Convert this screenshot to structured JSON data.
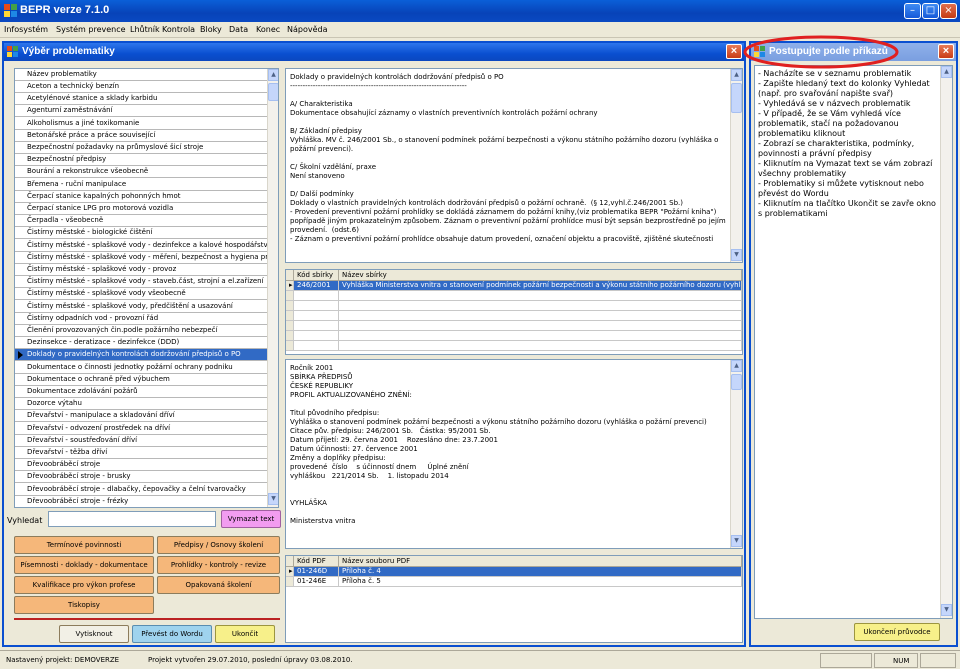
{
  "app": {
    "title": "BEPR verze 7.1.0"
  },
  "menu": [
    "Infosystém",
    "Systém prevence",
    "Lhůtník",
    "Kontrola",
    "Bloky",
    "Data",
    "Konec",
    "Nápověda"
  ],
  "window_buttons": {
    "minimize": "–",
    "maximize": "□",
    "close": "×"
  },
  "left_window": {
    "title": "Výběr problematiky",
    "close": "×",
    "list_header": "Název problematiky",
    "selected_index": 26,
    "items": [
      "Aceton a technický benzín",
      "Acetylénové stanice a sklady karbidu",
      "Agenturní zaměstnávání",
      "Alkoholismus a jiné toxikomanie",
      "Betonářské práce a práce související",
      "Bezpečnostní požadavky na průmyslové šicí stroje",
      "Bezpečnostní předpisy",
      "Bourání a rekonstrukce všeobecně",
      "Břemena - ruční manipulace",
      "Čerpací stanice kapalných pohonných hmot",
      "Čerpací stanice LPG pro motorová vozidla",
      "Čerpadla - všeobecně",
      "Čistírny městské - biologické čištění",
      "Čistírny městské - splaškové vody - dezinfekce a kalové hospodářství",
      "Čistírny městské - splaškové vody - měření, bezpečnost a hygiena práce",
      "Čistírny městské - splaškové vody - provoz",
      "Čistírny městské - splaškové vody - staveb.část, strojní a el.zařízení",
      "Čistírny městské - splaškové vody všeobecně",
      "Čistírny městské - splaškové vody, předčištění a usazování",
      "Čistírny odpadních vod - provozní řád",
      "Členění provozovaných čin.podle požárního nebezpečí",
      "Dezinsekce - deratizace - dezinfekce (DDD)",
      "Doklady o pravidelných kontrolách dodržování předpisů o PO",
      "Dokumentace o činnosti jednotky požární ochrany podniku",
      "Dokumentace o ochraně před výbuchem",
      "Dokumentace zdolávání požárů",
      "Dozorce výtahu",
      "Dřevařství - manipulace a skladování dříví",
      "Dřevařství - odvození prostředek na dříví",
      "Dřevařství - soustřeďování dříví",
      "Dřevařství - těžba dříví",
      "Dřevoobráběcí stroje",
      "Dřevoobráběcí stroje - brusky",
      "Dřevoobráběcí stroje - dlabačky, čepovačky a čelní tvarovačky",
      "Dřevoobráběcí stroje - frézky"
    ],
    "search_label": "Vyhledat",
    "search_value": "",
    "clear_button": "Vymazat text",
    "category_buttons": [
      "Termínové povinnosti",
      "Předpisy / Osnovy školení",
      "Písemnosti - doklady - dokumentace",
      "Prohlídky - kontroly - revize",
      "Kvalifikace pro výkon profese",
      "Opakovaná školení",
      "Tiskopisy"
    ],
    "print_button": "Vytisknout",
    "word_button": "Převést do Wordu",
    "close_button": "Ukončit"
  },
  "detail_text": "Doklady o pravidelných kontrolách dodržování předpisů o PO\n----------------------------------------------------------------------\n\nA/ Charakteristika\nDokumentace obsahující záznamy o vlastních preventivních kontrolách požární ochrany\n\nB/ Základní předpisy\nVyhláška. MV č. 246/2001 Sb., o stanovení podmínek požární bezpečnosti a výkonu státního požárního dozoru (vyhláška o požární prevenci).\n\nC/ Školní vzdělání, praxe\nNení stanoveno\n\nD/ Další podmínky\nDoklady o vlastních pravidelných kontrolách dodržování předpisů o požární ochraně.  (§ 12,vyhl.č.246/2001 Sb.)\n- Provedení preventivní požární prohlídky se dokládá záznamem do požární knihy,(viz problematika BEPR \"Požární kniha\") popřípadě jiným prokazatelným způsobem. Záznam o preventivní požární prohlídce musí být sepsán bezprostředně po jejím provedení.  (odst.6)\n- Záznam o preventivní požární prohlídce obsahuje datum provedení, označení objektu a pracoviště, zjištěné skutečnosti",
  "collection_table": {
    "headers": [
      "Kód sbírky",
      "Název sbírky"
    ],
    "rows": [
      [
        "246/2001",
        "Vyhláška Ministerstva vnitra o stanovení podmínek požární bezpečnosti a výkonu státního požárního dozoru (vyhláška"
      ]
    ]
  },
  "law_text": "Ročník 2001\nSBÍRKA PŘEDPISŮ\nČESKÉ REPUBLIKY\nPROFIL AKTUALIZOVANÉHO ZNĚNÍ:\n\nTitul původního předpisu:\nVyhláška o stanovení podmínek požární bezpečnosti a výkonu státního požárního dozoru (vyhláška o požární prevenci)\nCitace pův. předpisu: 246/2001 Sb.   Částka: 95/2001 Sb.\nDatum přijetí: 29. června 2001    Rozesláno dne: 23.7.2001\nDatum účinnosti: 27. července 2001\nZměny a doplňky předpisu:\nprovedené  číslo    s účinností dnem     Úplné znění\nvyhláškou   221/2014 Sb.    1. listopadu 2014\n\n\nVYHLÁŠKA\n\nMinisterstva vnitra",
  "pdf_table": {
    "headers": [
      "Kód PDF",
      "Název souboru PDF"
    ],
    "rows": [
      [
        "01-246D",
        "Příloha č. 4"
      ],
      [
        "01-246E",
        "Příloha č. 5"
      ]
    ]
  },
  "right_window": {
    "title": "Postupujte podle příkazů",
    "close": "×",
    "help_text": "- Nacházíte se v seznamu problematik\n- Zapište hledaný text do kolonky Vyhledat (např. pro svařování napište svař)\n- Vyhledává se v názvech problematik\n- V případě, že se Vám vyhledá více problematik, stačí na požadovanou problematiku kliknout\n- Zobrazí se charakteristika, podmínky, povinnosti a právní předpisy\n- Kliknutím na Vymazat text se vám zobrazí všechny problematiky\n- Problematiky si můžete vytisknout nebo převést do Wordu\n- Kliknutím na tlačítko Ukončit se zavře okno s problematikami",
    "end_button": "Ukončení průvodce"
  },
  "status": {
    "project": "Nastavený projekt: DEMOVERZE",
    "created": "Projekt vytvořen 29.07.2010, poslední úpravy 03.08.2010.",
    "num": "NUM"
  },
  "colors": {
    "accent": "#0a4fd0",
    "selection": "#316ac5",
    "highlight_ellipse": "#e02020"
  }
}
